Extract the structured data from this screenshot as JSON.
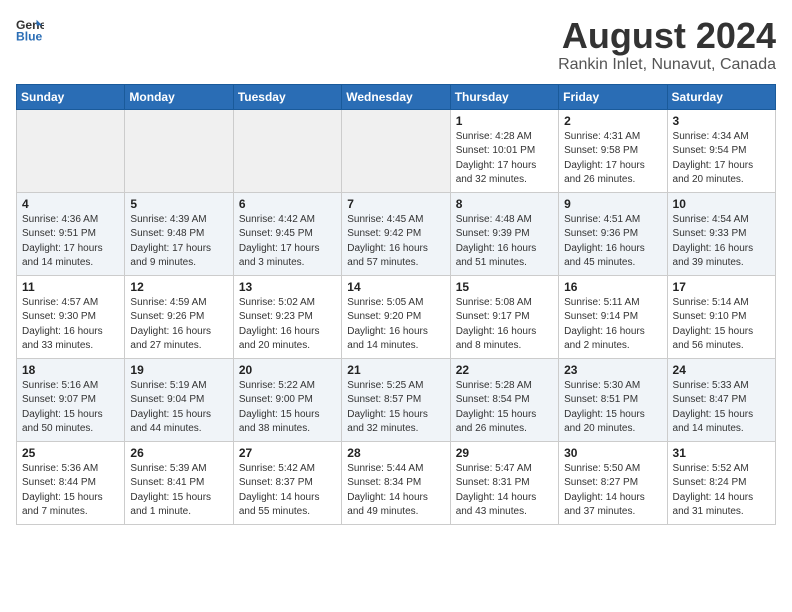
{
  "header": {
    "logo_general": "General",
    "logo_blue": "Blue",
    "month_title": "August 2024",
    "location": "Rankin Inlet, Nunavut, Canada"
  },
  "weekdays": [
    "Sunday",
    "Monday",
    "Tuesday",
    "Wednesday",
    "Thursday",
    "Friday",
    "Saturday"
  ],
  "rows": [
    [
      {
        "day": "",
        "info": ""
      },
      {
        "day": "",
        "info": ""
      },
      {
        "day": "",
        "info": ""
      },
      {
        "day": "",
        "info": ""
      },
      {
        "day": "1",
        "info": "Sunrise: 4:28 AM\nSunset: 10:01 PM\nDaylight: 17 hours\nand 32 minutes."
      },
      {
        "day": "2",
        "info": "Sunrise: 4:31 AM\nSunset: 9:58 PM\nDaylight: 17 hours\nand 26 minutes."
      },
      {
        "day": "3",
        "info": "Sunrise: 4:34 AM\nSunset: 9:54 PM\nDaylight: 17 hours\nand 20 minutes."
      }
    ],
    [
      {
        "day": "4",
        "info": "Sunrise: 4:36 AM\nSunset: 9:51 PM\nDaylight: 17 hours\nand 14 minutes."
      },
      {
        "day": "5",
        "info": "Sunrise: 4:39 AM\nSunset: 9:48 PM\nDaylight: 17 hours\nand 9 minutes."
      },
      {
        "day": "6",
        "info": "Sunrise: 4:42 AM\nSunset: 9:45 PM\nDaylight: 17 hours\nand 3 minutes."
      },
      {
        "day": "7",
        "info": "Sunrise: 4:45 AM\nSunset: 9:42 PM\nDaylight: 16 hours\nand 57 minutes."
      },
      {
        "day": "8",
        "info": "Sunrise: 4:48 AM\nSunset: 9:39 PM\nDaylight: 16 hours\nand 51 minutes."
      },
      {
        "day": "9",
        "info": "Sunrise: 4:51 AM\nSunset: 9:36 PM\nDaylight: 16 hours\nand 45 minutes."
      },
      {
        "day": "10",
        "info": "Sunrise: 4:54 AM\nSunset: 9:33 PM\nDaylight: 16 hours\nand 39 minutes."
      }
    ],
    [
      {
        "day": "11",
        "info": "Sunrise: 4:57 AM\nSunset: 9:30 PM\nDaylight: 16 hours\nand 33 minutes."
      },
      {
        "day": "12",
        "info": "Sunrise: 4:59 AM\nSunset: 9:26 PM\nDaylight: 16 hours\nand 27 minutes."
      },
      {
        "day": "13",
        "info": "Sunrise: 5:02 AM\nSunset: 9:23 PM\nDaylight: 16 hours\nand 20 minutes."
      },
      {
        "day": "14",
        "info": "Sunrise: 5:05 AM\nSunset: 9:20 PM\nDaylight: 16 hours\nand 14 minutes."
      },
      {
        "day": "15",
        "info": "Sunrise: 5:08 AM\nSunset: 9:17 PM\nDaylight: 16 hours\nand 8 minutes."
      },
      {
        "day": "16",
        "info": "Sunrise: 5:11 AM\nSunset: 9:14 PM\nDaylight: 16 hours\nand 2 minutes."
      },
      {
        "day": "17",
        "info": "Sunrise: 5:14 AM\nSunset: 9:10 PM\nDaylight: 15 hours\nand 56 minutes."
      }
    ],
    [
      {
        "day": "18",
        "info": "Sunrise: 5:16 AM\nSunset: 9:07 PM\nDaylight: 15 hours\nand 50 minutes."
      },
      {
        "day": "19",
        "info": "Sunrise: 5:19 AM\nSunset: 9:04 PM\nDaylight: 15 hours\nand 44 minutes."
      },
      {
        "day": "20",
        "info": "Sunrise: 5:22 AM\nSunset: 9:00 PM\nDaylight: 15 hours\nand 38 minutes."
      },
      {
        "day": "21",
        "info": "Sunrise: 5:25 AM\nSunset: 8:57 PM\nDaylight: 15 hours\nand 32 minutes."
      },
      {
        "day": "22",
        "info": "Sunrise: 5:28 AM\nSunset: 8:54 PM\nDaylight: 15 hours\nand 26 minutes."
      },
      {
        "day": "23",
        "info": "Sunrise: 5:30 AM\nSunset: 8:51 PM\nDaylight: 15 hours\nand 20 minutes."
      },
      {
        "day": "24",
        "info": "Sunrise: 5:33 AM\nSunset: 8:47 PM\nDaylight: 15 hours\nand 14 minutes."
      }
    ],
    [
      {
        "day": "25",
        "info": "Sunrise: 5:36 AM\nSunset: 8:44 PM\nDaylight: 15 hours\nand 7 minutes."
      },
      {
        "day": "26",
        "info": "Sunrise: 5:39 AM\nSunset: 8:41 PM\nDaylight: 15 hours\nand 1 minute."
      },
      {
        "day": "27",
        "info": "Sunrise: 5:42 AM\nSunset: 8:37 PM\nDaylight: 14 hours\nand 55 minutes."
      },
      {
        "day": "28",
        "info": "Sunrise: 5:44 AM\nSunset: 8:34 PM\nDaylight: 14 hours\nand 49 minutes."
      },
      {
        "day": "29",
        "info": "Sunrise: 5:47 AM\nSunset: 8:31 PM\nDaylight: 14 hours\nand 43 minutes."
      },
      {
        "day": "30",
        "info": "Sunrise: 5:50 AM\nSunset: 8:27 PM\nDaylight: 14 hours\nand 37 minutes."
      },
      {
        "day": "31",
        "info": "Sunrise: 5:52 AM\nSunset: 8:24 PM\nDaylight: 14 hours\nand 31 minutes."
      }
    ]
  ]
}
